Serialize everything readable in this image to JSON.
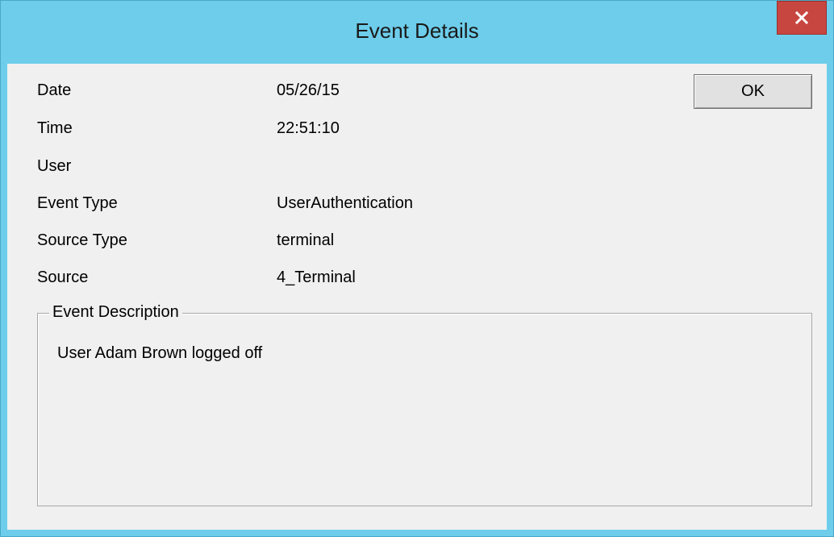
{
  "window": {
    "title": "Event Details",
    "close_icon": "close-x-icon"
  },
  "buttons": {
    "ok_label": "OK"
  },
  "fields": [
    {
      "label": "Date",
      "value": "05/26/15"
    },
    {
      "label": "Time",
      "value": "22:51:10"
    },
    {
      "label": "User",
      "value": ""
    },
    {
      "label": "Event Type",
      "value": "UserAuthentication"
    },
    {
      "label": "Source Type",
      "value": "terminal"
    },
    {
      "label": "Source",
      "value": "4_Terminal"
    }
  ],
  "description": {
    "legend": "Event Description",
    "text": "User Adam Brown logged off"
  },
  "colors": {
    "titlebar": "#6dcdeb",
    "close_button": "#c84640",
    "client_background": "#f0f0f0"
  }
}
